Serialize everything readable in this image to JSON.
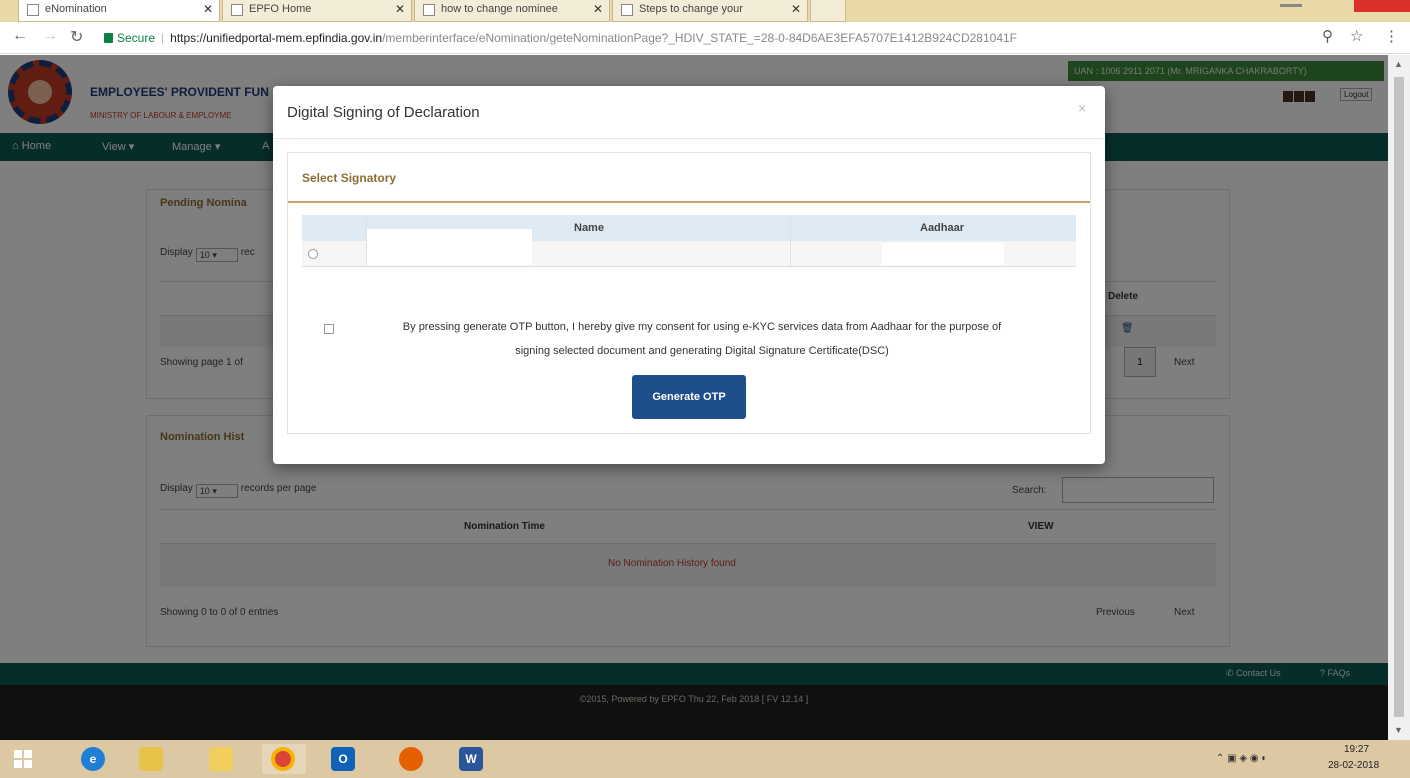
{
  "browser": {
    "tabs": [
      {
        "title": "eNomination",
        "active": true
      },
      {
        "title": "EPFO Home",
        "active": false
      },
      {
        "title": "how to change nominee",
        "active": false
      },
      {
        "title": "Steps to change your",
        "active": false
      }
    ],
    "secure_label": "Secure",
    "url_host": "https://unifiedportal-mem.epfindia.gov.in",
    "url_path": "/memberinterface/eNomination/geteNominationPage?_HDIV_STATE_=28-0-84D6AE3EFA5707E1412B924CD281041F"
  },
  "site": {
    "org_name": "EMPLOYEES' PROVIDENT FUN",
    "org_sub": "MINISTRY OF LABOUR & EMPLOYME",
    "uan_text": "UAN : 1006 2911 2071 (Mr. MRIGANKA CHAKRABORTY)",
    "logout": "Logout",
    "nav": [
      "Home",
      "View",
      "Manage",
      "A"
    ],
    "pending_title": "Pending Nomina",
    "display_label": "Display",
    "display_value": "10",
    "records_stub": "rec",
    "delete_header": "Delete",
    "showing_page": "Showing page 1 of",
    "page_num": "1",
    "next": "Next",
    "history_title": "Nomination Hist",
    "records_per_page": "records per page",
    "search_label": "Search:",
    "col_time": "Nomination Time",
    "col_view": "VIEW",
    "no_history": "No Nomination History found",
    "showing_entries": "Showing 0 to 0 of 0 entries",
    "previous": "Previous",
    "contact": "Contact Us",
    "faqs": "FAQs",
    "footer": "©2015, Powered by EPFO Thu 22, Feb 2018 [ FV 12.14 ]"
  },
  "modal": {
    "title": "Digital Signing of Declaration",
    "close": "×",
    "section_title": "Select Signatory",
    "col_name": "Name",
    "col_aadhaar": "Aadhaar",
    "consent_line1": "By pressing generate OTP button, I hereby give my consent for using e-KYC services data from Aadhaar for the purpose of",
    "consent_line2": "signing selected document and generating Digital Signature Certificate(DSC)",
    "button": "Generate OTP"
  },
  "taskbar": {
    "time": "19:27",
    "date": "28-02-2018"
  },
  "colors": {
    "nav_teal": "#0e5a55",
    "button_blue": "#1f4e8c",
    "accent_gold": "#8a6f30"
  }
}
